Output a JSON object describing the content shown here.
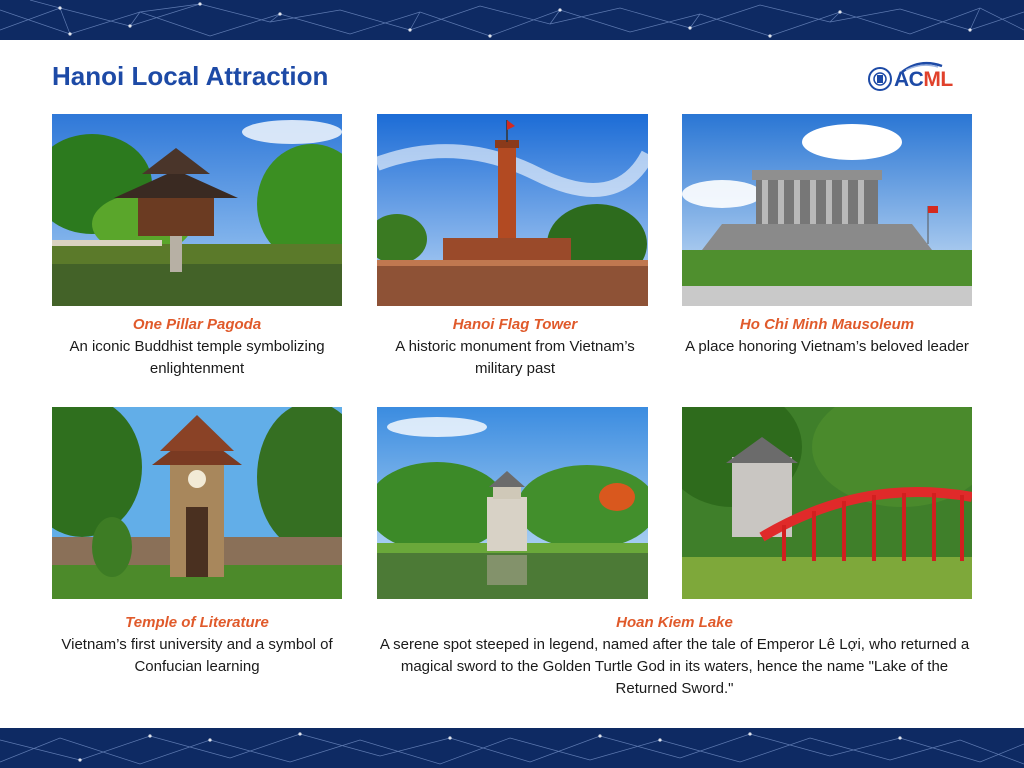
{
  "page": {
    "title": "Hanoi Local Attraction",
    "logo": {
      "text_a": "AC",
      "text_b": "ML",
      "emblem": "hanoi-emblem-icon"
    }
  },
  "attractions": [
    {
      "name": "One Pillar Pagoda",
      "description": "An iconic Buddhist temple symbolizing enlightenment",
      "photo": "one-pillar-pagoda-photo"
    },
    {
      "name": "Hanoi Flag Tower",
      "description": "A historic monument from Vietnam’s military past",
      "photo": "hanoi-flag-tower-photo"
    },
    {
      "name": "Ho Chi Minh Mausoleum",
      "description": "A place honoring Vietnam’s beloved leader",
      "photo": "ho-chi-minh-mausoleum-photo"
    },
    {
      "name": "Temple of Literature",
      "description": "Vietnam’s first university and a symbol of Confucian learning",
      "photo": "temple-of-literature-photo"
    },
    {
      "name": "Hoan Kiem Lake",
      "description": "A serene spot steeped in legend, named after the tale of Emperor Lê Lợi, who returned a magical sword to the Golden Turtle God in its waters, hence the name \"Lake of the Returned Sword.\"",
      "photo": "hoan-kiem-lake-photo"
    }
  ],
  "colors": {
    "title": "#1d4aa6",
    "attraction_name": "#e05a2b",
    "band": "#0e2a63",
    "logo_red": "#e0412b"
  }
}
